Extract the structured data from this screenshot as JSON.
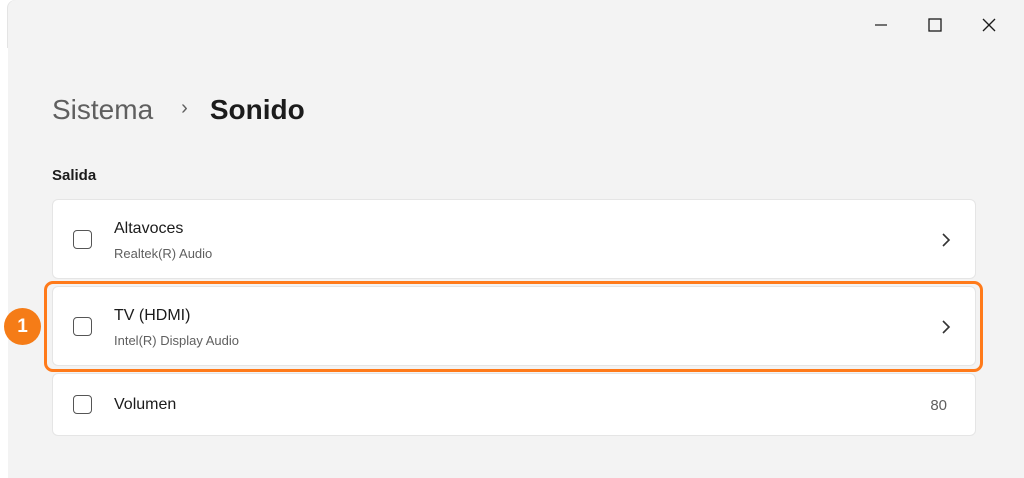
{
  "window": {
    "minimize_icon": "minimize-icon",
    "maximize_icon": "maximize-icon",
    "close_icon": "close-icon"
  },
  "breadcrumb": {
    "parent": "Sistema",
    "separator": "›",
    "current": "Sonido"
  },
  "output": {
    "section_label": "Salida",
    "devices": [
      {
        "title": "Altavoces",
        "subtitle": "Realtek(R) Audio",
        "checked": false
      },
      {
        "title": "TV (HDMI)",
        "subtitle": "Intel(R) Display Audio",
        "checked": false
      }
    ],
    "volume": {
      "label": "Volumen",
      "value": "80",
      "checked": false
    }
  },
  "annotation": {
    "step_number": "1",
    "color": "#f57c17"
  },
  "colors": {
    "window_background": "#f3f3f3",
    "card_background": "#ffffff",
    "highlight": "#ff7a1a"
  }
}
